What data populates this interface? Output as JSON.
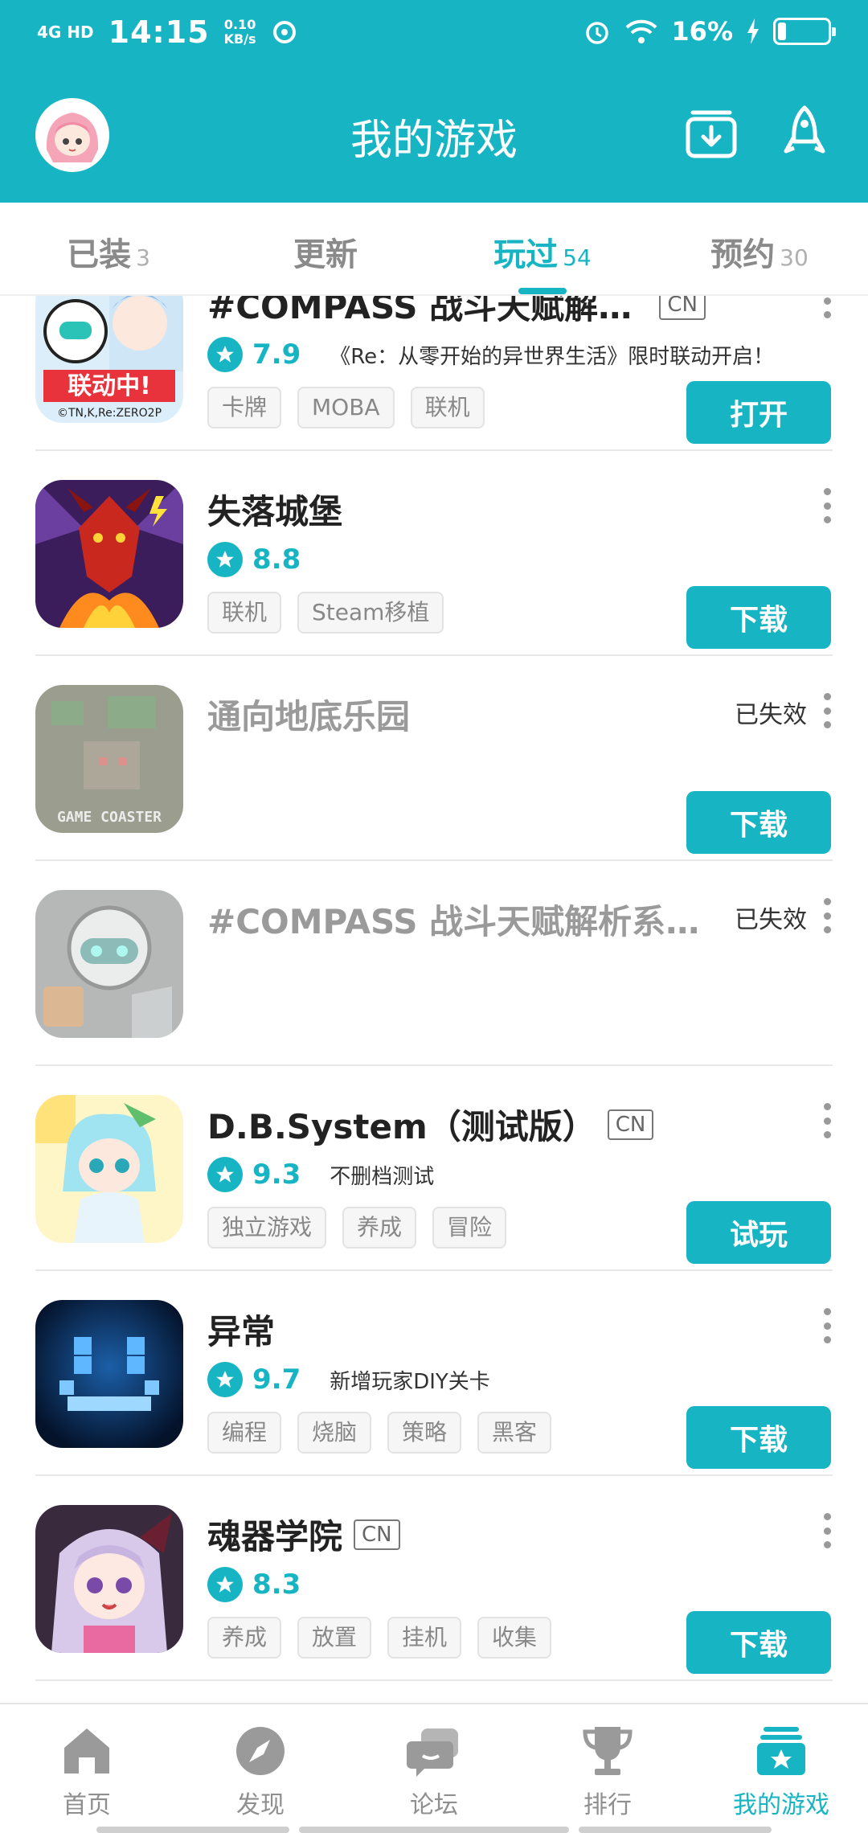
{
  "status_bar": {
    "network": "4G HD",
    "time": "14:15",
    "speed_value": "0.10",
    "speed_unit": "KB/s",
    "battery_percent": "16%",
    "battery_level": 0.16
  },
  "header": {
    "title": "我的游戏"
  },
  "tabs": [
    {
      "label": "已装",
      "count": "3"
    },
    {
      "label": "更新",
      "count": ""
    },
    {
      "label": "玩过",
      "count": "54"
    },
    {
      "label": "预约",
      "count": "30"
    }
  ],
  "games": [
    {
      "name": "#COMPASS 战斗天赋解析...",
      "region": "CN",
      "score": "7.9",
      "desc": "《Re：从零开始的异世界生活》限时联动开启！",
      "tags": [
        "卡牌",
        "MOBA",
        "联机"
      ],
      "action": "打开",
      "status": "",
      "icon": "compass-collab-icon"
    },
    {
      "name": "失落城堡",
      "region": "",
      "score": "8.8",
      "desc": "",
      "tags": [
        "联机",
        "Steam移植"
      ],
      "action": "下载",
      "status": "",
      "icon": "red-dragon-icon"
    },
    {
      "name": "通向地底乐园",
      "region": "",
      "score": "",
      "desc": "",
      "tags": [],
      "action": "下载",
      "status": "已失效",
      "icon": "game-coaster-icon"
    },
    {
      "name": "#COMPASS 战斗天赋解析系统...",
      "region": "",
      "score": "",
      "desc": "",
      "tags": [],
      "action": "",
      "status": "已失效",
      "icon": "compass-robot-icon"
    },
    {
      "name": "D.B.System（测试版）",
      "region": "CN",
      "score": "9.3",
      "desc": "不删档测试",
      "tags": [
        "独立游戏",
        "养成",
        "冒险"
      ],
      "action": "试玩",
      "status": "",
      "icon": "anime-dragon-girl-icon"
    },
    {
      "name": "异常",
      "region": "",
      "score": "9.7",
      "desc": "新增玩家DIY关卡",
      "tags": [
        "编程",
        "烧脑",
        "策略",
        "黑客"
      ],
      "action": "下载",
      "status": "",
      "icon": "pixel-face-icon"
    },
    {
      "name": "魂器学院",
      "region": "CN",
      "score": "8.3",
      "desc": "",
      "tags": [
        "养成",
        "放置",
        "挂机",
        "收集"
      ],
      "action": "下载",
      "status": "",
      "icon": "anime-girl-icon"
    }
  ],
  "bottom_nav": [
    {
      "label": "首页"
    },
    {
      "label": "发现"
    },
    {
      "label": "论坛"
    },
    {
      "label": "排行"
    },
    {
      "label": "我的游戏"
    }
  ],
  "icon_text": {
    "collab_badge": "联动中!",
    "collab_copyright": "©TN,K,Re:ZERO2P",
    "coaster_caption": "GAME COASTER"
  },
  "colors": {
    "accent": "#17b5c4",
    "tag_bg": "#f6f6f6",
    "text_dark": "#222222"
  }
}
